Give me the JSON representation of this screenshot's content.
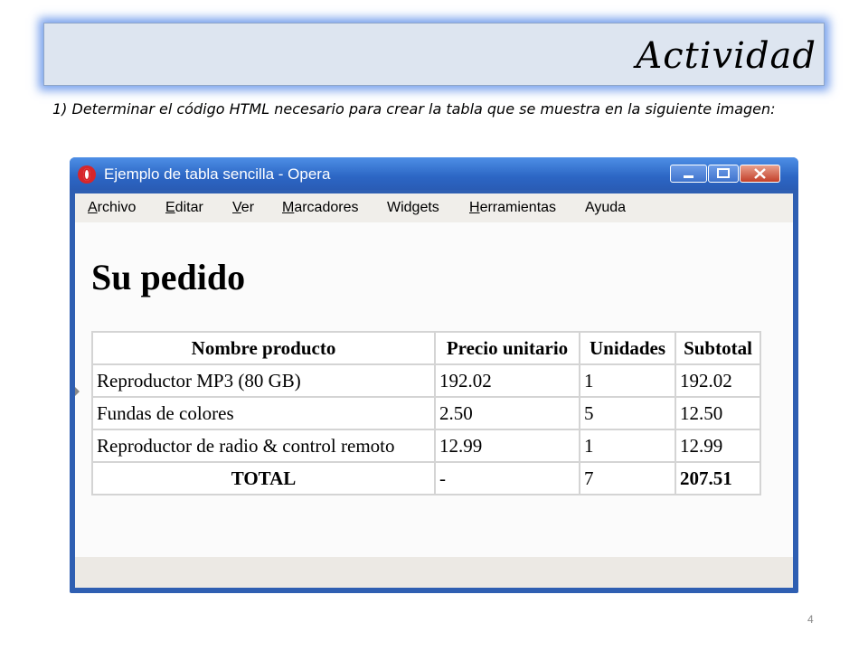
{
  "slide": {
    "title": "Actividad",
    "instruction": "1) Determinar el código HTML necesario para crear la tabla que se muestra en la siguiente imagen:",
    "page_number": "4"
  },
  "window": {
    "title": "Ejemplo de tabla sencilla - Opera",
    "app_icon": "opera-icon",
    "controls": {
      "minimize": "minimize-icon",
      "maximize": "maximize-icon",
      "close": "close-icon"
    },
    "menu": [
      {
        "accel": "A",
        "rest": "rchivo"
      },
      {
        "accel": "E",
        "rest": "ditar"
      },
      {
        "accel": "V",
        "rest": "er"
      },
      {
        "accel": "M",
        "rest": "arcadores"
      },
      {
        "accel": "",
        "rest": "Widgets"
      },
      {
        "accel": "H",
        "rest": "erramientas"
      },
      {
        "accel": "",
        "rest": "Ayuda"
      }
    ]
  },
  "page": {
    "heading": "Su pedido",
    "table": {
      "headers": [
        "Nombre producto",
        "Precio unitario",
        "Unidades",
        "Subtotal"
      ],
      "rows": [
        [
          "Reproductor MP3 (80 GB)",
          "192.02",
          "1",
          "192.02"
        ],
        [
          "Fundas de colores",
          "2.50",
          "5",
          "12.50"
        ],
        [
          "Reproductor de radio & control remoto",
          "12.99",
          "1",
          "12.99"
        ],
        [
          "TOTAL",
          "-",
          "7",
          "207.51"
        ]
      ]
    }
  }
}
